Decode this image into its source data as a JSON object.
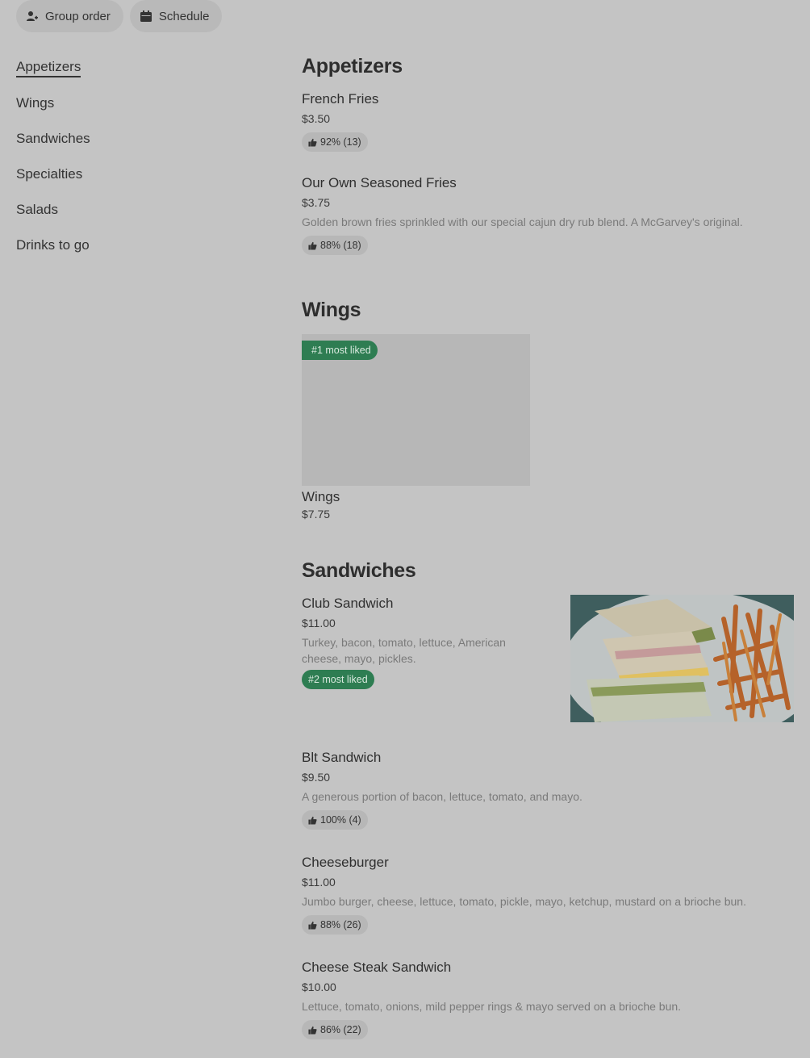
{
  "topbar": {
    "group_order": "Group order",
    "schedule": "Schedule"
  },
  "nav": [
    "Appetizers",
    "Wings",
    "Sandwiches",
    "Specialties",
    "Salads",
    "Drinks to go"
  ],
  "sections": {
    "appetizers": {
      "title": "Appetizers",
      "items": [
        {
          "name": "French Fries",
          "price": "$3.50",
          "rating": "92% (13)"
        },
        {
          "name": "Our Own Seasoned Fries",
          "price": "$3.75",
          "desc": "Golden brown fries sprinkled with our special cajun dry rub blend. A McGarvey's original.",
          "rating": "88% (18)"
        }
      ]
    },
    "wings": {
      "title": "Wings",
      "badge": "#1 most liked",
      "items": [
        {
          "name": "Wings",
          "price": "$7.75"
        }
      ]
    },
    "sandwiches": {
      "title": "Sandwiches",
      "items": [
        {
          "name": "Club Sandwich",
          "price": "$11.00",
          "desc": "Turkey, bacon, tomato, lettuce, American cheese, mayo, pickles.",
          "badge": "#2 most liked"
        },
        {
          "name": "Blt Sandwich",
          "price": "$9.50",
          "desc": "A generous portion of bacon, lettuce, tomato, and mayo.",
          "rating": "100% (4)"
        },
        {
          "name": "Cheeseburger",
          "price": "$11.00",
          "desc": "Jumbo burger, cheese, lettuce, tomato, pickle, mayo, ketchup, mustard on a brioche bun.",
          "rating": "88% (26)"
        },
        {
          "name": "Cheese Steak Sandwich",
          "price": "$10.00",
          "desc": "Lettuce, tomato, onions, mild pepper rings & mayo served on a brioche bun.",
          "rating": "86% (22)"
        }
      ]
    }
  },
  "colors": {
    "background": "#c4c4c4",
    "badge_green": "#2e7d52",
    "pill_bg": "#b9b9b9"
  },
  "icons": {
    "group_order": "person-add-icon",
    "schedule": "calendar-icon",
    "rating": "thumbs-up-icon"
  }
}
